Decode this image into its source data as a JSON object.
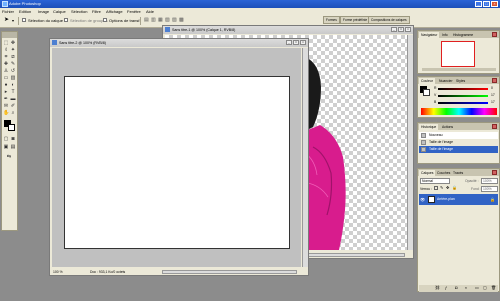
{
  "app": {
    "title": "Adobe Photoshop"
  },
  "menu": [
    "Fichier",
    "Edition",
    "Image",
    "Calque",
    "Sélection",
    "Filtre",
    "Affichage",
    "Fenêtre",
    "Aide"
  ],
  "options": {
    "selection_calque": "Sélection du calque",
    "selection_groupes": "Sélection de groupes",
    "options_transf": "Options de transf."
  },
  "workspace_tabs": [
    "Formes",
    "Forme prédéfinie",
    "Compositions de calques"
  ],
  "documents": {
    "back": {
      "title": "Sans titre-1 @ 100% (Calque 1, RVB/8)",
      "zoom": "100 %",
      "doc_info": "Doc : 933,0 Ko/2,05 Mo"
    },
    "front": {
      "title": "Sans titre-2 @ 100% (RVB/8)",
      "zoom": "100 %",
      "doc_info": "Doc : 933,1 Ko/0 octets"
    }
  },
  "panels": {
    "navigator": {
      "tabs": [
        "Navigateur",
        "Info",
        "Histogramme"
      ]
    },
    "color": {
      "tabs": [
        "Couleur",
        "Nuancier",
        "Styles"
      ],
      "channels": [
        {
          "label": "R",
          "value": "0"
        },
        {
          "label": "V",
          "value": "17"
        },
        {
          "label": "B",
          "value": "17"
        }
      ]
    },
    "history": {
      "tabs": [
        "Historique",
        "Actions"
      ],
      "items": [
        "Nouveau",
        "Taille de l'image",
        "Taille de l'image"
      ]
    },
    "layers": {
      "tabs": [
        "Calques",
        "Couches",
        "Tracés"
      ],
      "mode": "Normal",
      "opacity_label": "Opacité :",
      "opacity": "100%",
      "fill_label": "Fond :",
      "fill": "100%",
      "lock_label": "Verrou :",
      "layer": "Arrière-plan"
    }
  },
  "colors": {
    "accent": "#3163c5",
    "shirt": "#d81c8d",
    "hair": "#1a1a1a"
  }
}
